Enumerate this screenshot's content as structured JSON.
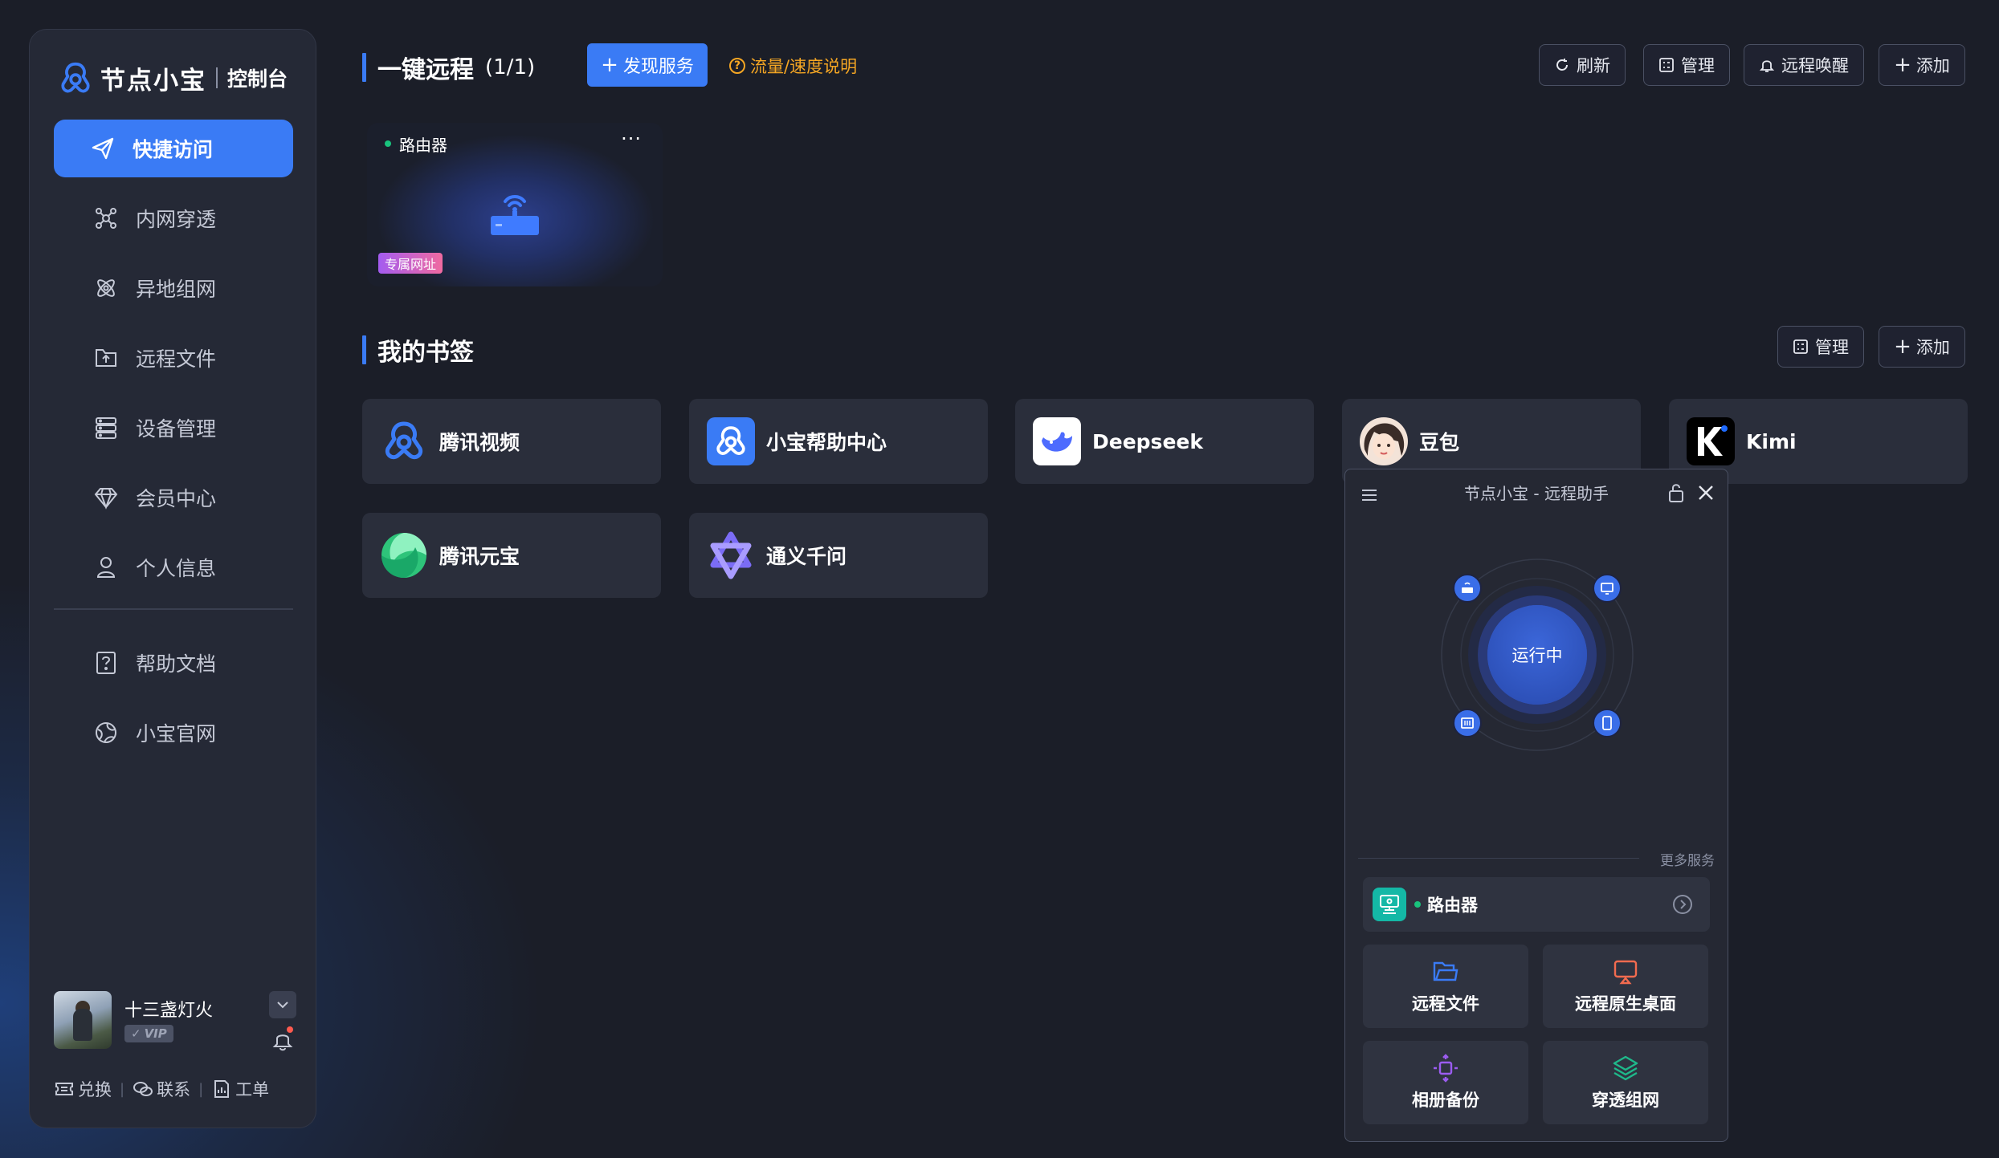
{
  "brand": {
    "name": "节点小宝",
    "sub": "控制台"
  },
  "sidebar": {
    "items": [
      {
        "label": "快捷访问",
        "icon": "paper-plane-icon",
        "active": true
      },
      {
        "label": "内网穿透",
        "icon": "network-nodes-icon"
      },
      {
        "label": "异地组网",
        "icon": "atom-icon"
      },
      {
        "label": "远程文件",
        "icon": "folder-upload-icon"
      },
      {
        "label": "设备管理",
        "icon": "server-stack-icon"
      },
      {
        "label": "会员中心",
        "icon": "diamond-icon"
      },
      {
        "label": "个人信息",
        "icon": "user-icon"
      }
    ],
    "secondary": [
      {
        "label": "帮助文档",
        "icon": "help-doc-icon"
      },
      {
        "label": "小宝官网",
        "icon": "globe-icon"
      }
    ]
  },
  "user": {
    "name": "十三盏灯火",
    "badge": "VIP"
  },
  "footer": {
    "exchange": "兑换",
    "contact": "联系",
    "ticket": "工单"
  },
  "remote": {
    "title": "一键远程",
    "count": "(1/1)",
    "discover_label": "发现服务",
    "flow_label": "流量/速度说明",
    "actions": {
      "refresh": "刷新",
      "manage": "管理",
      "wake": "远程唤醒",
      "add": "添加"
    },
    "device": {
      "name": "路由器",
      "tag": "专属网址",
      "more": "···"
    }
  },
  "bookmarks": {
    "title": "我的书签",
    "actions": {
      "manage": "管理",
      "add": "添加"
    },
    "items": [
      {
        "label": "腾讯视频"
      },
      {
        "label": "小宝帮助中心"
      },
      {
        "label": "Deepseek"
      },
      {
        "label": "豆包"
      },
      {
        "label": "Kimi"
      },
      {
        "label": "腾讯元宝"
      },
      {
        "label": "通义千问"
      }
    ]
  },
  "assistant": {
    "title": "节点小宝 - 远程助手",
    "status": "运行中",
    "more_services": "更多服务",
    "device_name": "路由器",
    "services": [
      {
        "label": "远程文件",
        "icon": "folder-icon"
      },
      {
        "label": "远程原生桌面",
        "icon": "remote-desktop-icon"
      },
      {
        "label": "相册备份",
        "icon": "photo-backup-icon"
      },
      {
        "label": "穿透组网",
        "icon": "layers-icon"
      }
    ]
  },
  "colors": {
    "accent": "#3a7bf5",
    "warning": "#f5a623",
    "online": "#19c37d"
  }
}
